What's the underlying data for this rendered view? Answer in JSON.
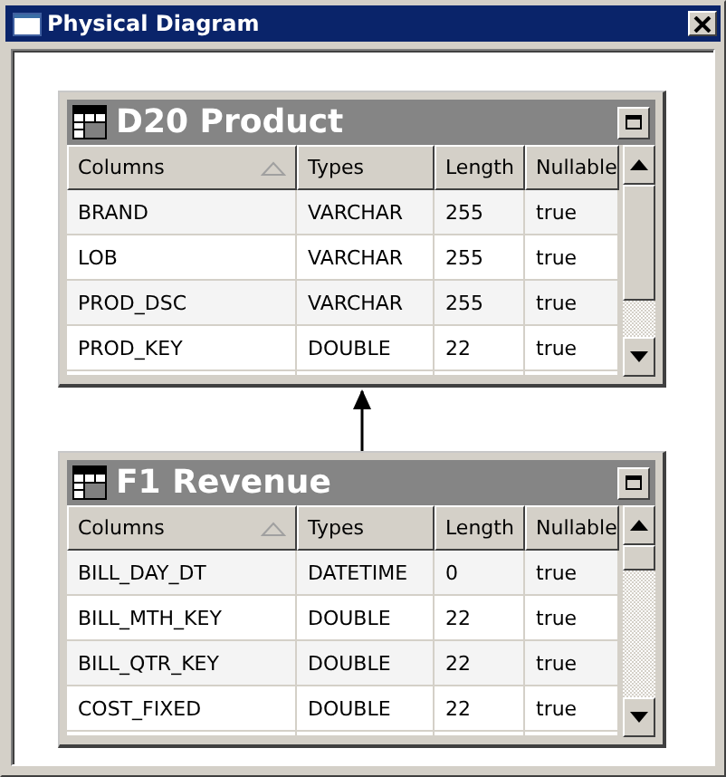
{
  "window": {
    "title": "Physical Diagram"
  },
  "tables": [
    {
      "title": "D20 Product",
      "columns": [
        {
          "label": "Columns",
          "sorted": true
        },
        {
          "label": "Types",
          "sorted": false
        },
        {
          "label": "Length",
          "sorted": false
        },
        {
          "label": "Nullable",
          "sorted": false
        }
      ],
      "rows": [
        [
          "BRAND",
          "VARCHAR",
          "255",
          "true"
        ],
        [
          "LOB",
          "VARCHAR",
          "255",
          "true"
        ],
        [
          "PROD_DSC",
          "VARCHAR",
          "255",
          "true"
        ],
        [
          "PROD_KEY",
          "DOUBLE",
          "22",
          "true"
        ]
      ]
    },
    {
      "title": "F1 Revenue",
      "columns": [
        {
          "label": "Columns",
          "sorted": true
        },
        {
          "label": "Types",
          "sorted": false
        },
        {
          "label": "Length",
          "sorted": false
        },
        {
          "label": "Nullable",
          "sorted": false
        }
      ],
      "rows": [
        [
          "BILL_DAY_DT",
          "DATETIME",
          "0",
          "true"
        ],
        [
          "BILL_MTH_KEY",
          "DOUBLE",
          "22",
          "true"
        ],
        [
          "BILL_QTR_KEY",
          "DOUBLE",
          "22",
          "true"
        ],
        [
          "COST_FIXED",
          "DOUBLE",
          "22",
          "true"
        ]
      ]
    }
  ]
}
